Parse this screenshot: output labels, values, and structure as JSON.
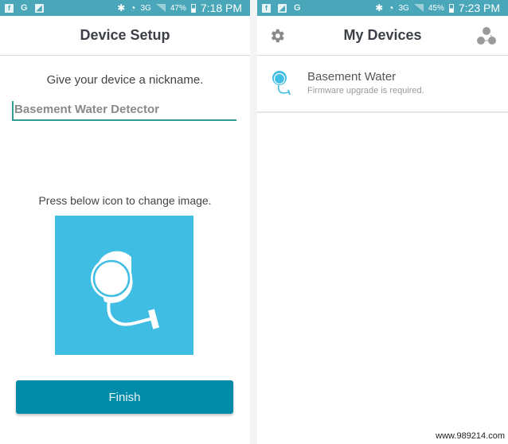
{
  "left_screen": {
    "statusbar": {
      "notification_icons": [
        "facebook-icon",
        "google-icon",
        "gallery-icon"
      ],
      "network": "3G",
      "battery": "47%",
      "time": "7:18 PM"
    },
    "title": "Device Setup",
    "nickname_prompt": "Give your device a nickname.",
    "nickname_value": "Basement Water Detector",
    "image_prompt": "Press below icon to change image.",
    "image_tile_color": "#40bde2",
    "finish_label": "Finish",
    "finish_color": "#008ba8"
  },
  "right_screen": {
    "statusbar": {
      "notification_icons": [
        "facebook-icon",
        "gallery-icon",
        "google-icon"
      ],
      "network": "3G",
      "battery": "45%",
      "time": "7:23 PM"
    },
    "title": "My Devices",
    "devices": [
      {
        "name": "Basement Water",
        "status": "Firmware upgrade is required."
      }
    ]
  },
  "watermark": "www.989214.com"
}
